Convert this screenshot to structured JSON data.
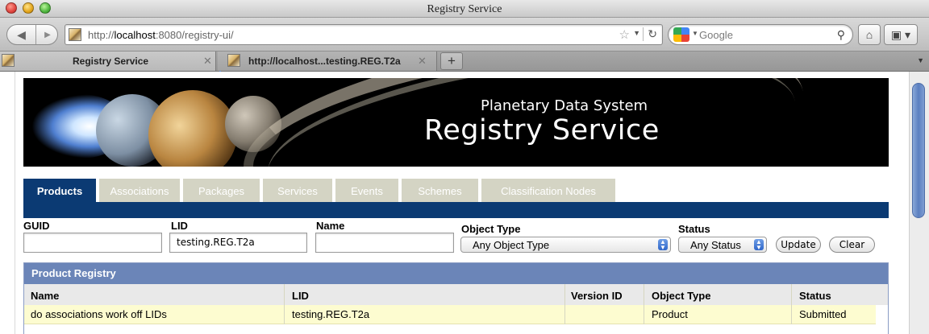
{
  "window": {
    "title": "Registry Service"
  },
  "navbar": {
    "url_prefix": "http://",
    "url_host": "localhost",
    "url_rest": ":8080/registry-ui/",
    "search_placeholder": "Google"
  },
  "browser_tabs": [
    {
      "label": "Registry Service",
      "active": true
    },
    {
      "label": "http://localhost...testing.REG.T2a",
      "active": false
    }
  ],
  "banner": {
    "subtitle": "Planetary Data System",
    "title": "Registry Service"
  },
  "app_tabs": [
    {
      "label": "Products",
      "active": true
    },
    {
      "label": "Associations",
      "active": false
    },
    {
      "label": "Packages",
      "active": false
    },
    {
      "label": "Services",
      "active": false
    },
    {
      "label": "Events",
      "active": false
    },
    {
      "label": "Schemes",
      "active": false
    },
    {
      "label": "Classification Nodes",
      "active": false
    }
  ],
  "filters": {
    "guid_label": "GUID",
    "guid_value": "",
    "lid_label": "LID",
    "lid_value": "testing.REG.T2a",
    "name_label": "Name",
    "name_value": "",
    "object_type_label": "Object Type",
    "object_type_selected": "Any Object Type",
    "status_label": "Status",
    "status_selected": "Any Status",
    "update_label": "Update",
    "clear_label": "Clear"
  },
  "registry": {
    "title": "Product Registry",
    "columns": [
      "Name",
      "LID",
      "Version ID",
      "Object Type",
      "Status"
    ],
    "rows": [
      {
        "name": "do associations work off LIDs",
        "lid": "testing.REG.T2a",
        "version_id": "",
        "object_type": "Product",
        "status": "Submitted"
      }
    ]
  },
  "colors": {
    "active_tab": "#0b3a73",
    "inactive_tab": "#d4d4c4",
    "panel_header": "#6b85b8",
    "row_highlight": "#fdfcd0"
  }
}
